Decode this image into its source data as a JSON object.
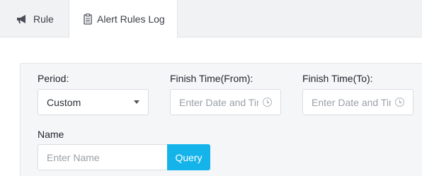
{
  "tabs": {
    "rule": {
      "label": "Rule",
      "icon": "megaphone-icon"
    },
    "log": {
      "label": "Alert Rules Log",
      "icon": "clipboard-icon"
    }
  },
  "filters": {
    "period": {
      "label": "Period:",
      "value": "Custom"
    },
    "finish_from": {
      "label": "Finish Time(From):",
      "placeholder": "Enter Date and Time"
    },
    "finish_to": {
      "label": "Finish Time(To):",
      "placeholder": "Enter Date and Time"
    },
    "name": {
      "label": "Name",
      "placeholder": "Enter Name"
    },
    "query_label": "Query"
  },
  "colors": {
    "accent": "#14b4eb",
    "tab_bar": "#f1f2f4",
    "panel": "#f5f6f8"
  }
}
